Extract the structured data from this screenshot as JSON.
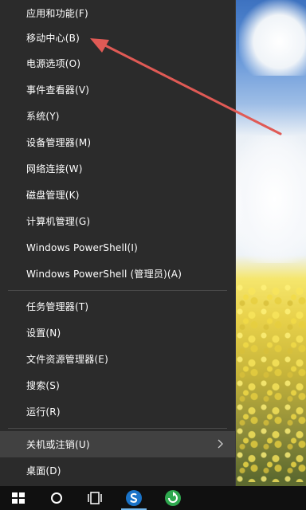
{
  "menu": {
    "items": [
      {
        "label": "应用和功能(F)"
      },
      {
        "label": "移动中心(B)"
      },
      {
        "label": "电源选项(O)"
      },
      {
        "label": "事件查看器(V)"
      },
      {
        "label": "系统(Y)"
      },
      {
        "label": "设备管理器(M)"
      },
      {
        "label": "网络连接(W)"
      },
      {
        "label": "磁盘管理(K)"
      },
      {
        "label": "计算机管理(G)"
      },
      {
        "label": "Windows PowerShell(I)"
      },
      {
        "label": "Windows PowerShell (管理员)(A)"
      },
      {
        "label": "任务管理器(T)"
      },
      {
        "label": "设置(N)"
      },
      {
        "label": "文件资源管理器(E)"
      },
      {
        "label": "搜索(S)"
      },
      {
        "label": "运行(R)"
      },
      {
        "label": "关机或注销(U)"
      },
      {
        "label": "桌面(D)"
      }
    ],
    "submenu_icon": "chevron-right-icon"
  },
  "annotation": {
    "color": "#e05a55",
    "icon": "red-arrow-pointer"
  },
  "taskbar": {
    "icons": [
      "windows-start-icon",
      "search-circle-icon",
      "task-view-icon",
      "browser-s-icon",
      "green-app-icon"
    ]
  },
  "colors": {
    "menu_bg": "#2b2b2b",
    "hover_bg": "#414141",
    "text": "#ffffff",
    "accent": "#76b9ed"
  }
}
